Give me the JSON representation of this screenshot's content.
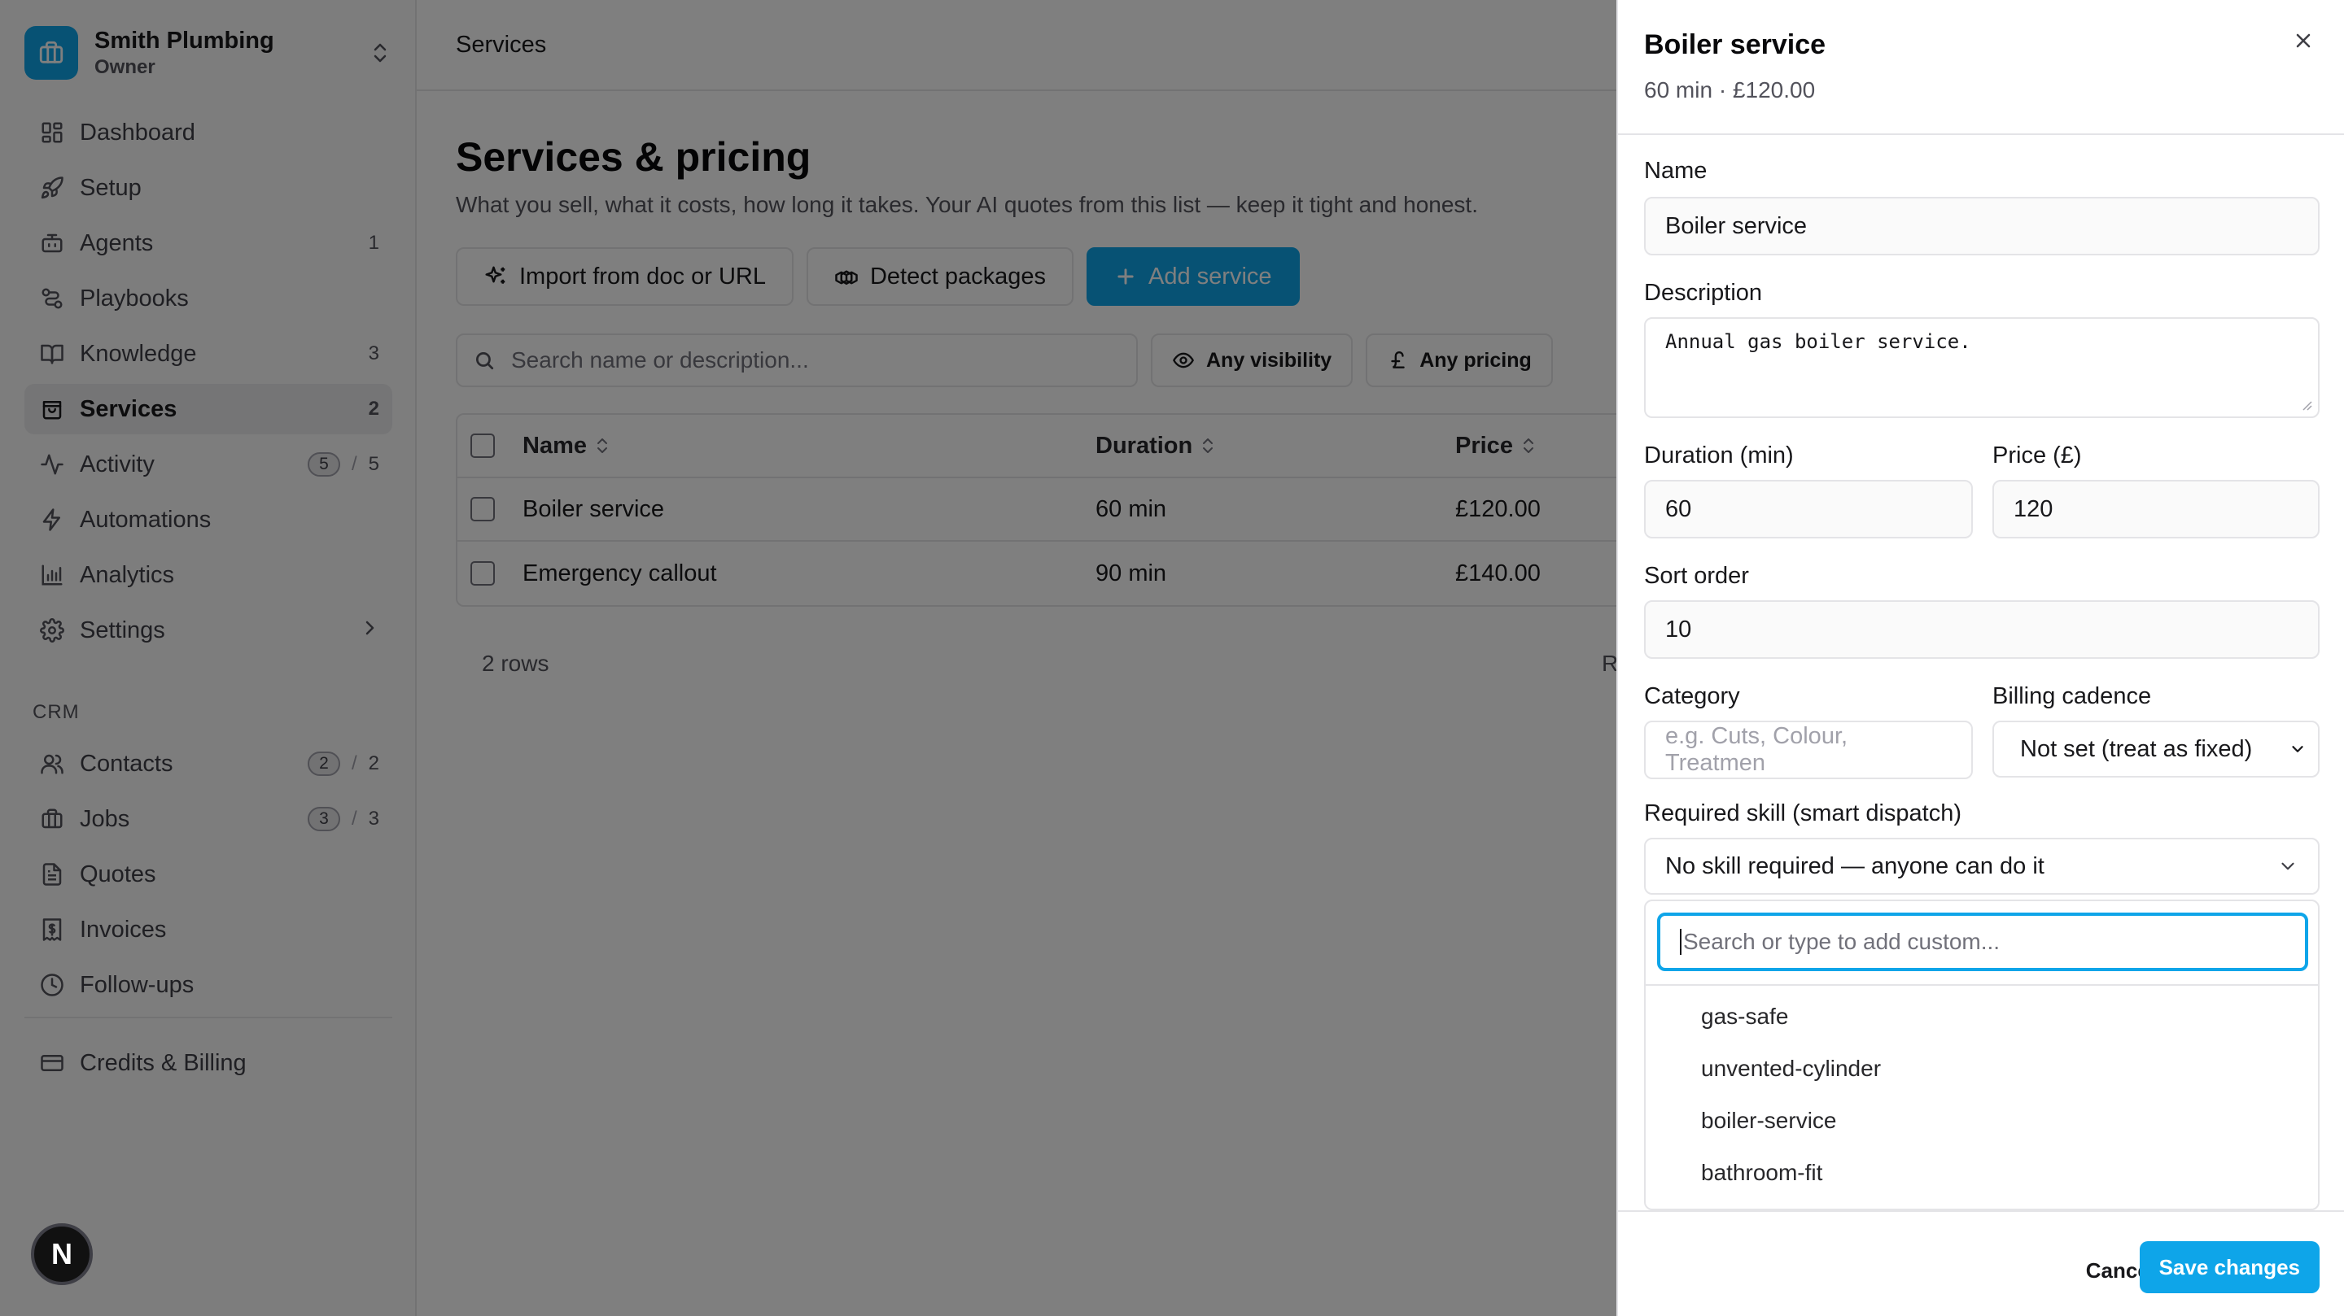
{
  "workspace": {
    "name": "Smith Plumbing",
    "role": "Owner"
  },
  "nav": [
    {
      "label": "Dashboard",
      "icon": "dashboard-icon"
    },
    {
      "label": "Setup",
      "icon": "rocket-icon"
    },
    {
      "label": "Agents",
      "icon": "bot-icon",
      "count": "1"
    },
    {
      "label": "Playbooks",
      "icon": "workflow-icon"
    },
    {
      "label": "Knowledge",
      "icon": "book-icon",
      "count": "3"
    },
    {
      "label": "Services",
      "icon": "shopping-bag-icon",
      "count": "2",
      "active": true
    },
    {
      "label": "Activity",
      "icon": "activity-icon",
      "pill": "5",
      "count": "5"
    },
    {
      "label": "Automations",
      "icon": "zap-icon"
    },
    {
      "label": "Analytics",
      "icon": "bar-chart-icon"
    },
    {
      "label": "Settings",
      "icon": "gear-icon"
    }
  ],
  "crm": {
    "label": "CRM",
    "items": [
      {
        "label": "Contacts",
        "icon": "users-icon",
        "pill": "2",
        "count": "2"
      },
      {
        "label": "Jobs",
        "icon": "briefcase-icon",
        "pill": "3",
        "count": "3"
      },
      {
        "label": "Quotes",
        "icon": "file-text-icon"
      },
      {
        "label": "Invoices",
        "icon": "receipt-icon"
      },
      {
        "label": "Follow-ups",
        "icon": "clock-icon"
      }
    ]
  },
  "billing": {
    "label": "Credits & Billing",
    "icon": "credit-card-icon"
  },
  "badge": {
    "letter": "N"
  },
  "topbar": {
    "title": "Services"
  },
  "page": {
    "title": "Services & pricing",
    "subtitle": "What you sell, what it costs, how long it takes. Your AI quotes from this list — keep it tight and honest."
  },
  "actions": {
    "import": "Import from doc or URL",
    "detect": "Detect packages",
    "add": "Add service"
  },
  "filters": {
    "search_placeholder": "Search name or description...",
    "visibility": "Any visibility",
    "pricing": "Any pricing"
  },
  "table": {
    "columns": [
      "Name",
      "Duration",
      "Price"
    ],
    "rows": [
      {
        "name": "Boiler service",
        "duration": "60 min",
        "price": "£120.00"
      },
      {
        "name": "Emergency callout",
        "duration": "90 min",
        "price": "£140.00"
      }
    ],
    "row_count": "2 rows",
    "truncated_right": "R"
  },
  "drawer": {
    "title": "Boiler service",
    "subtitle": "60 min · £120.00",
    "name_label": "Name",
    "name_value": "Boiler service",
    "description_label": "Description",
    "description_value": "Annual gas boiler service.",
    "duration_label": "Duration (min)",
    "duration_value": "60",
    "price_label": "Price (£)",
    "price_value": "120",
    "sort_label": "Sort order",
    "sort_value": "10",
    "category_label": "Category",
    "category_placeholder": "e.g. Cuts, Colour, Treatmen",
    "billing_label": "Billing cadence",
    "billing_value": "Not set (treat as fixed)",
    "skill_label": "Required skill (smart dispatch)",
    "skill_value": "No skill required — anyone can do it",
    "skill_search_placeholder": "Search or type to add custom...",
    "skill_options": [
      "gas-safe",
      "unvented-cylinder",
      "boiler-service",
      "bathroom-fit"
    ],
    "cancel": "Cancel",
    "save": "Save changes"
  },
  "colors": {
    "accent": "#0ea5e9",
    "overlay": "rgba(0,0,0,0.5)"
  }
}
